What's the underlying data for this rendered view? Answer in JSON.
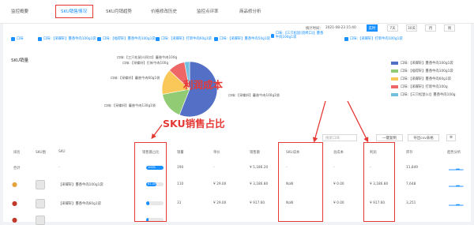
{
  "tabs": [
    "监控概要",
    "SKU销售情况",
    "SKU月销趋势",
    "价格修改历史",
    "监控点评率",
    "商品修分析"
  ],
  "time": {
    "label": "统计时间：",
    "value": "2021-08-23 15:40",
    "buttons": [
      "实时",
      "7天",
      "30天",
      "月",
      "周"
    ]
  },
  "chips": [
    "口味",
    "口味:【采蝶轩】蔓香牛肉100g1袋",
    "口味:【福得轩】蔓香牛肉100g1袋",
    "口味:【采蝶轩】打新牛肉60g1袋",
    "口味:【采蝶轩】蔓香牛肉50g1袋",
    "口味:【三只松鼠(烧烤口)】蔓香牛肉100g1袋",
    "口味:【采蝶轩】打新牛肉100g1袋"
  ],
  "section_title": "SKU销量",
  "legend": [
    {
      "label": "口味:【采蝶轩】蔓香牛肉100g1袋",
      "color": "#5470c6"
    },
    {
      "label": "口味:【福得轩】蔓香牛肉100g1袋",
      "color": "#91cc75"
    },
    {
      "label": "口味:【采蝶轩】蔓香牛肉60g1袋",
      "color": "#fac858"
    },
    {
      "label": "口味:【采蝶轩】打新牛肉100g",
      "color": "#ee6666"
    },
    {
      "label": "口味:【三只松鼠(s)】蔓香牛肉100g",
      "color": "#73c0de"
    }
  ],
  "pie_labels": [
    "口味:【三只松鼠(s)同口】蔓香牛肉100g",
    "口味:【采蝶轩】打新牛肉100g",
    "口味:【采蝶轩】蔓香牛肉60g1袋",
    "口味:【采蝶轩】蔓香牛肉100g1袋",
    "口味:【采蝶轩】蔓香牛肉130g1袋"
  ],
  "chart_data": {
    "type": "pie",
    "title": "SKU销量",
    "values": [
      56,
      16,
      15,
      10,
      3
    ],
    "labels": [
      "【采蝶轩】蔓香牛肉100g1袋",
      "【福得轩】蔓香牛肉100g1袋",
      "【采蝶轩】蔓香牛肉60g1袋",
      "【采蝶轩】打新牛肉100g",
      "【三只松鼠】蔓香牛肉100g"
    ],
    "colors": [
      "#5470c6",
      "#91cc75",
      "#fac858",
      "#ee6666",
      "#73c0de"
    ]
  },
  "annotations": {
    "sku_share": "SKU销售占比",
    "profit_cost": "利润成本"
  },
  "toolbar": {
    "search": "搜索口味",
    "copy": "一键复制",
    "export": "导出csv表格"
  },
  "columns": [
    "排名",
    "SKU图",
    "SKU",
    "销售额占比",
    "销量",
    "单价",
    "销售额",
    "SKU成本",
    "总成本",
    "利润",
    "库存",
    "趋势分析"
  ],
  "rows": [
    {
      "rank": "合计",
      "sku": "-",
      "share": "100%",
      "pct": 100,
      "qty": "190",
      "price": "-",
      "sales": "¥ 5,186.20",
      "cost": "-",
      "total": "-",
      "profit": "-",
      "stock": "11,849"
    },
    {
      "rank": "",
      "sku": "【采蝶轩】蔓香牛肉100g1袋",
      "share": "61.45%",
      "pct": 61,
      "qty": "110",
      "price": "¥ 29.00",
      "sales": "¥ 3,186.80",
      "cost": "NaN",
      "total": "¥ 0.00",
      "profit": "¥ 3,186.80",
      "stock": "7,648"
    },
    {
      "rank": "",
      "sku": "【采蝶轩】蔓香牛肉60g1袋",
      "share": "",
      "pct": 18,
      "qty": "31",
      "price": "¥ 29.00",
      "sales": "¥ 917.60",
      "cost": "NaN",
      "total": "¥ 0.00",
      "profit": "¥ 917.60",
      "stock": "3,251"
    },
    {
      "rank": "",
      "sku": "",
      "share": "",
      "pct": 12,
      "qty": "",
      "price": "",
      "sales": "",
      "cost": "",
      "total": "",
      "profit": "",
      "stock": ""
    }
  ]
}
